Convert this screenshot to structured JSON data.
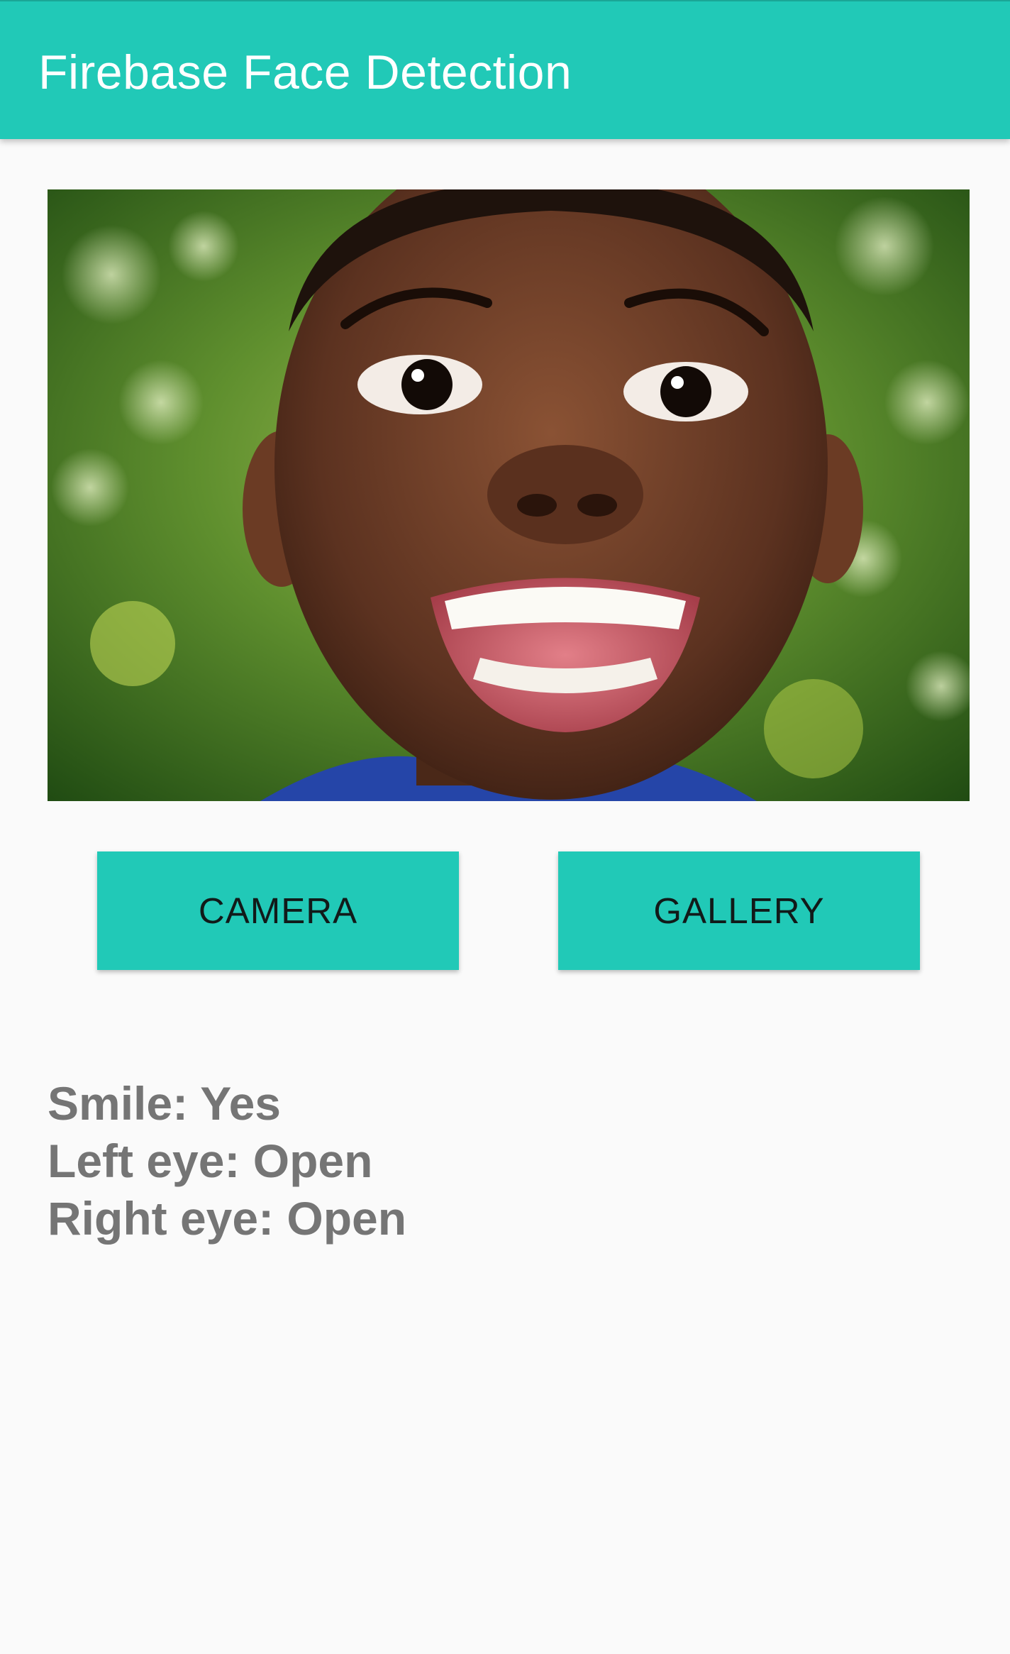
{
  "app_bar": {
    "title": "Firebase Face Detection",
    "color": "#21c9b7"
  },
  "image": {
    "content": "photo of a smiling child"
  },
  "buttons": {
    "camera_label": "CAMERA",
    "gallery_label": "GALLERY"
  },
  "results": {
    "smile": "Smile: Yes",
    "left_eye": "Left eye: Open",
    "right_eye": "Right eye: Open"
  }
}
